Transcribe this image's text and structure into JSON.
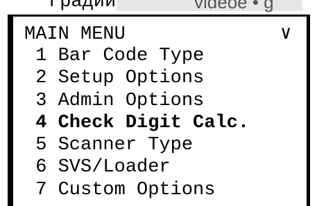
{
  "top_strip": {
    "left_fragment": "градий",
    "right_fragment": "vidéoé • g"
  },
  "screen": {
    "title": "MAIN MENU",
    "chevron": "∨",
    "selected_index": 4,
    "items": [
      {
        "number": "1",
        "label": "Bar Code Type",
        "text": " 1 Bar Code Type"
      },
      {
        "number": "2",
        "label": "Setup Options",
        "text": " 2 Setup Options"
      },
      {
        "number": "3",
        "label": "Admin Options",
        "text": " 3 Admin Options"
      },
      {
        "number": "4",
        "label": "Check Digit Calc.",
        "text": " 4 Check Digit Calc."
      },
      {
        "number": "5",
        "label": "Scanner Type",
        "text": " 5 Scanner Type"
      },
      {
        "number": "6",
        "label": "SVS/Loader",
        "text": " 6 SVS/Loader"
      },
      {
        "number": "7",
        "label": "Custom Options",
        "text": " 7 Custom Options"
      }
    ]
  }
}
